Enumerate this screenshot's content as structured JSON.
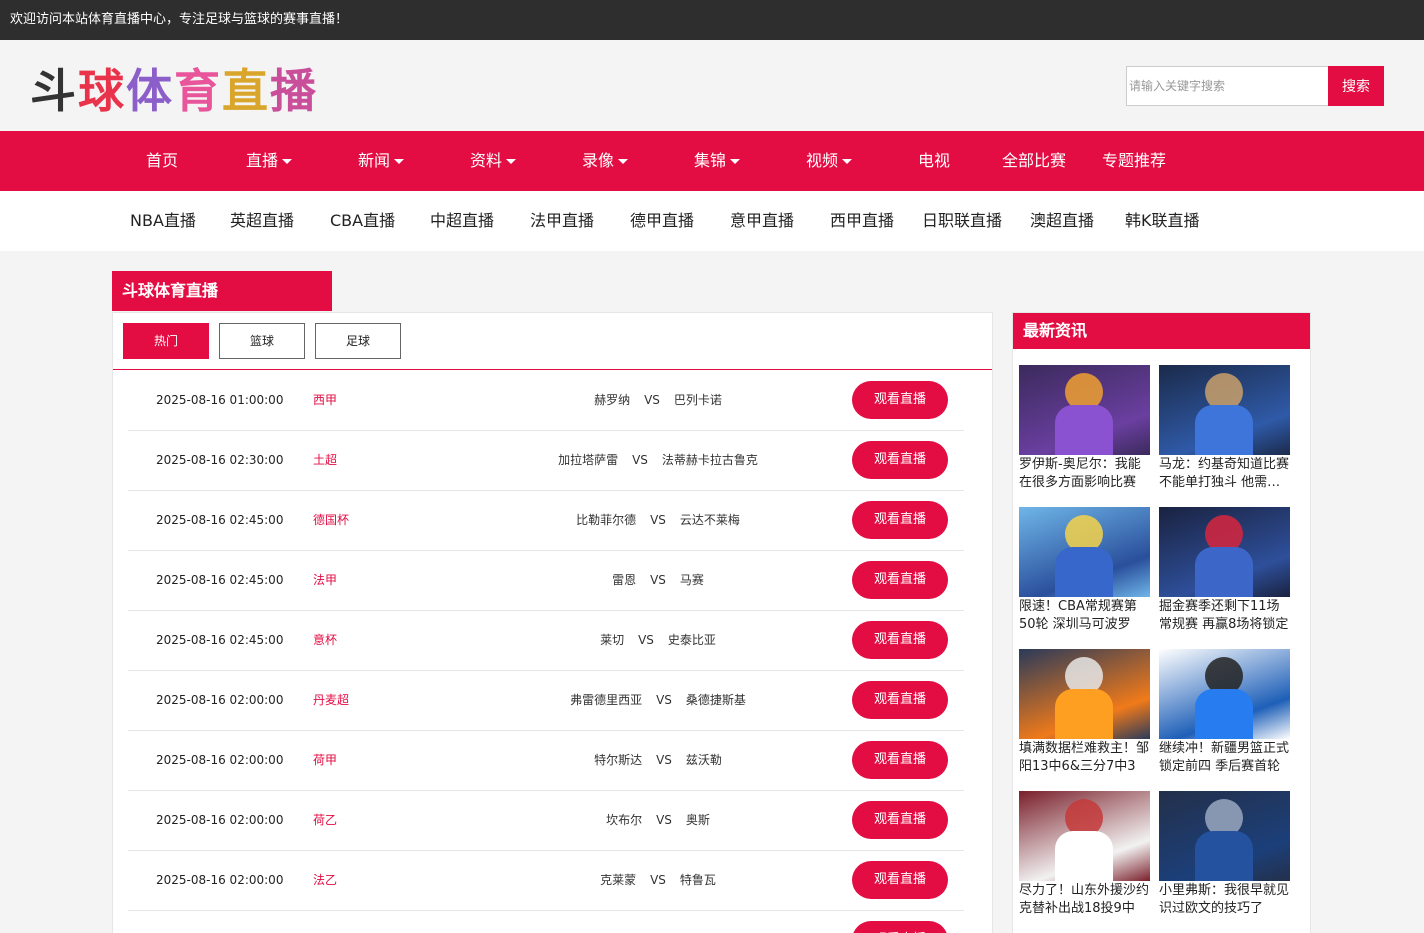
{
  "topbar": {
    "welcome": "欢迎访问本站体育直播中心，专注足球与篮球的赛事直播！"
  },
  "logo": {
    "chars": [
      "斗",
      "球",
      "体",
      "育",
      "直",
      "播"
    ]
  },
  "search": {
    "placeholder": "请输入关键字搜索",
    "button": "搜索"
  },
  "main_nav": [
    {
      "label": "首页"
    },
    {
      "label": "直播"
    },
    {
      "label": "新闻"
    },
    {
      "label": "资料"
    },
    {
      "label": "录像"
    },
    {
      "label": "集锦"
    },
    {
      "label": "视频"
    },
    {
      "label": "电视"
    },
    {
      "label": "全部比赛"
    },
    {
      "label": "专题推荐"
    }
  ],
  "sub_nav": [
    "NBA直播",
    "英超直播",
    "CBA直播",
    "中超直播",
    "法甲直播",
    "德甲直播",
    "意甲直播",
    "西甲直播",
    "日职联直播",
    "澳超直播",
    "韩K联直播"
  ],
  "section": {
    "title": "斗球体育直播",
    "tabs": [
      "热门",
      "篮球",
      "足球"
    ],
    "watch_label": "观看直播",
    "vs_label": "VS",
    "matches": [
      {
        "time": "2025-08-16 01:00:00",
        "league": "西甲",
        "home": "赫罗纳",
        "away": "巴列卡诺"
      },
      {
        "time": "2025-08-16 02:30:00",
        "league": "土超",
        "home": "加拉塔萨雷",
        "away": "法蒂赫卡拉古鲁克"
      },
      {
        "time": "2025-08-16 02:45:00",
        "league": "德国杯",
        "home": "比勒菲尔德",
        "away": "云达不莱梅"
      },
      {
        "time": "2025-08-16 02:45:00",
        "league": "法甲",
        "home": "雷恩",
        "away": "马赛"
      },
      {
        "time": "2025-08-16 02:45:00",
        "league": "意杯",
        "home": "莱切",
        "away": "史泰比亚"
      },
      {
        "time": "2025-08-16 02:00:00",
        "league": "丹麦超",
        "home": "弗雷德里西亚",
        "away": "桑德捷斯基"
      },
      {
        "time": "2025-08-16 02:00:00",
        "league": "荷甲",
        "home": "特尔斯达",
        "away": "兹沃勒"
      },
      {
        "time": "2025-08-16 02:00:00",
        "league": "荷乙",
        "home": "坎布尔",
        "away": "奥斯"
      },
      {
        "time": "2025-08-16 02:00:00",
        "league": "法乙",
        "home": "克莱蒙",
        "away": "特鲁瓦"
      }
    ]
  },
  "sidebar": {
    "title": "最新资讯",
    "news": [
      {
        "caption": "罗伊斯-奥尼尔：我能在很多方面影响比赛",
        "thumb_colors": [
          "#3b2a5c",
          "#6a3fa0",
          "#f0a030"
        ]
      },
      {
        "caption": "马龙：约基奇知道比赛不能单打独斗 他需要队友",
        "thumb_colors": [
          "#1b2a4a",
          "#2f5aa8",
          "#c9a06a"
        ]
      },
      {
        "caption": "限速！CBA常规赛第50轮 深圳马可波罗",
        "thumb_colors": [
          "#6fb6e8",
          "#2a4f9c",
          "#f4d24a"
        ]
      },
      {
        "caption": "掘金赛季还剩下11场常规赛 再赢8场将锁定",
        "thumb_colors": [
          "#1a2240",
          "#2e4f9a",
          "#d7263d"
        ]
      },
      {
        "caption": "填满数据栏难救主！邹阳13中6&三分7中3",
        "thumb_colors": [
          "#2a3a5a",
          "#f07a1a",
          "#e8e8e8"
        ]
      },
      {
        "caption": "继续冲！新疆男篮正式锁定前四 季后赛首轮",
        "thumb_colors": [
          "#ffffff",
          "#1e5fb8",
          "#222222"
        ]
      },
      {
        "caption": "尽力了！山东外援沙约克替补出战18投9中",
        "thumb_colors": [
          "#7a1f2a",
          "#f2f2f2",
          "#c43a3a"
        ]
      },
      {
        "caption": "小里弗斯：我很早就见识过欧文的技巧了",
        "thumb_colors": [
          "#23304a",
          "#1c3f7a",
          "#9aa8c0"
        ]
      }
    ]
  }
}
